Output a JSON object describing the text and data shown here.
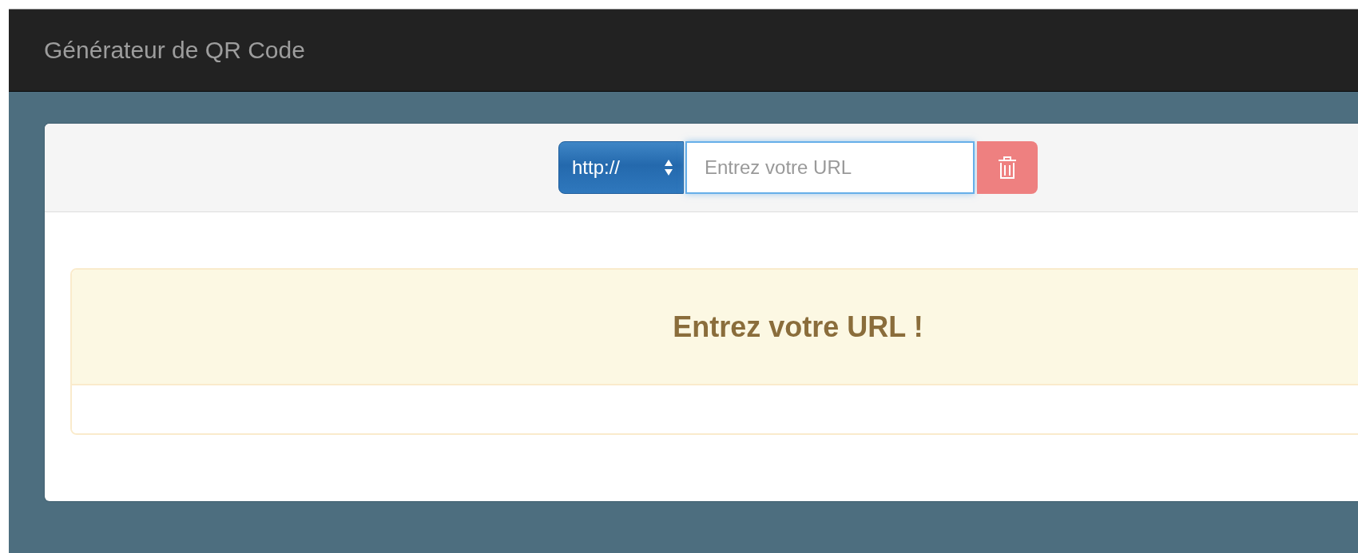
{
  "navbar": {
    "title": "Générateur de QR Code"
  },
  "form": {
    "protocol": "http://",
    "url_placeholder": "Entrez votre URL"
  },
  "alert": {
    "message": "Entrez votre URL !"
  }
}
